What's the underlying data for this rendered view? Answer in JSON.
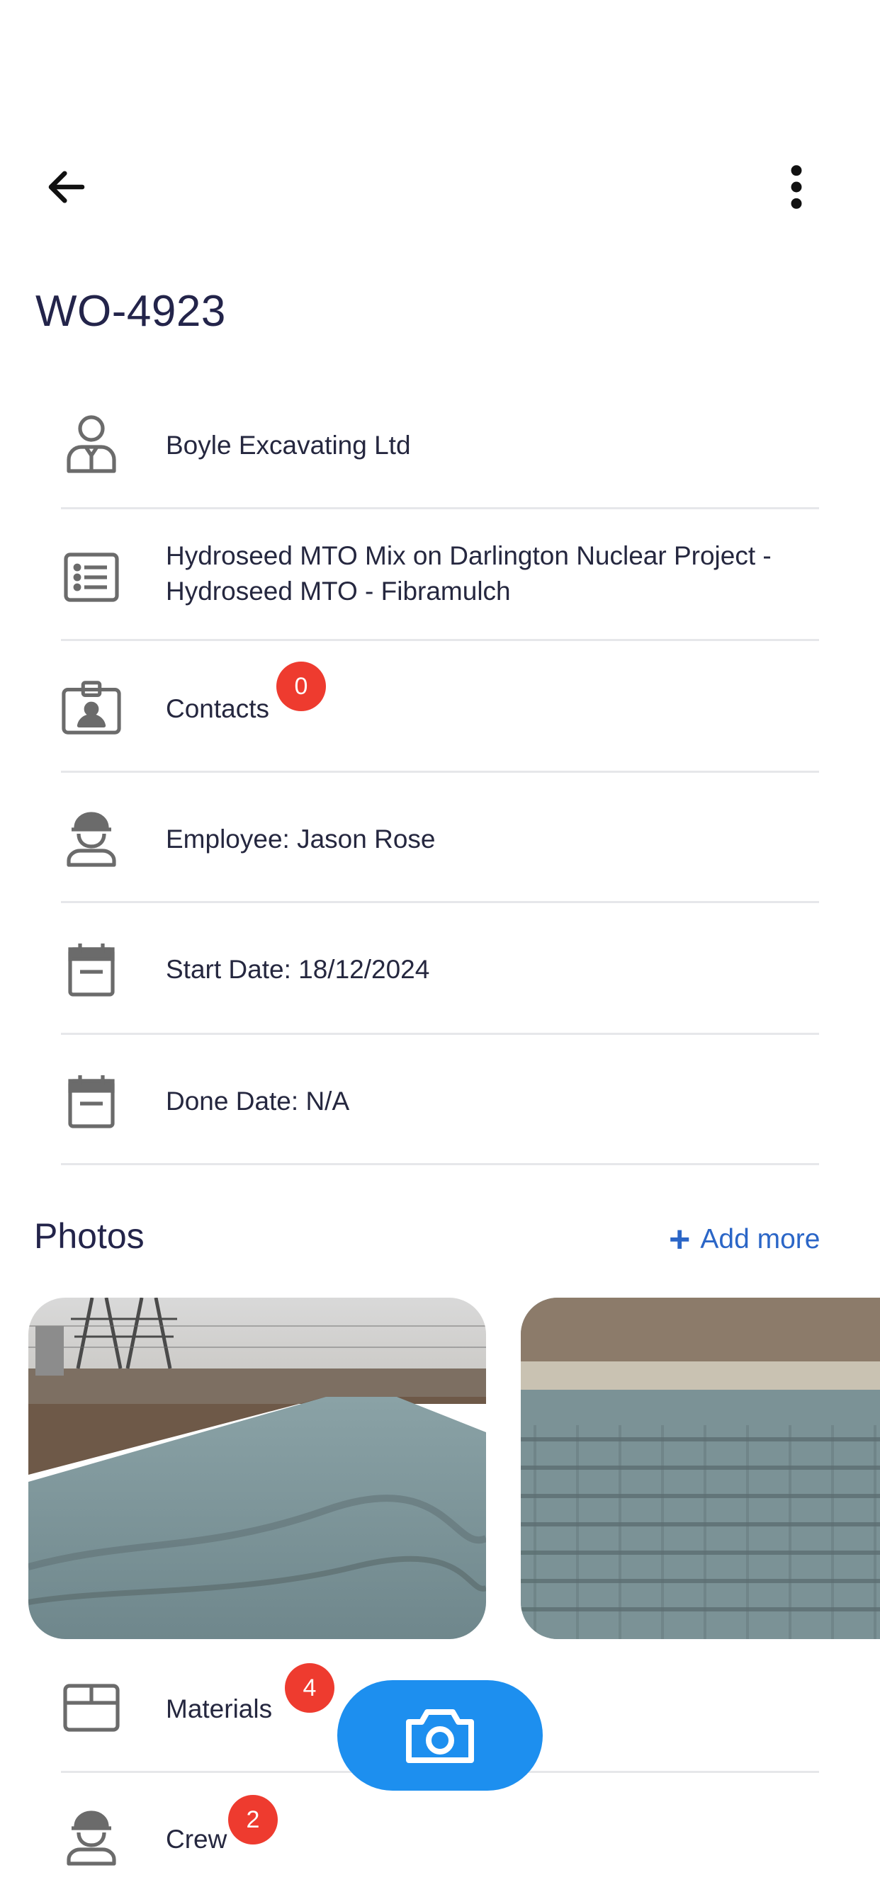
{
  "header": {
    "title": "WO-4923",
    "back_icon": "arrow-left-icon",
    "more_icon": "more-vertical-icon"
  },
  "details": {
    "customer": {
      "label": "Boyle Excavating Ltd",
      "icon": "customer-icon"
    },
    "job": {
      "label": "Hydroseed MTO Mix on Darlington Nuclear Project  - Hydroseed MTO - Fibramulch",
      "icon": "list-icon"
    },
    "contacts": {
      "label": "Contacts",
      "badge": "0",
      "icon": "contact-card-icon"
    },
    "employee": {
      "label": "Employee: Jason Rose",
      "icon": "hardhat-worker-icon"
    },
    "start_date": {
      "label": "Start Date: 18/12/2024",
      "icon": "calendar-icon"
    },
    "done_date": {
      "label": "Done Date: N/A",
      "icon": "calendar-icon"
    }
  },
  "photos": {
    "title": "Photos",
    "add_more_label": "Add more",
    "add_icon": "plus-icon"
  },
  "sections": {
    "materials": {
      "label": "Materials",
      "badge": "4",
      "icon": "box-icon"
    },
    "crew": {
      "label": "Crew",
      "badge": "2",
      "icon": "hardhat-worker-icon"
    }
  },
  "fab": {
    "icon": "camera-icon"
  },
  "colors": {
    "accent_blue": "#1d8fef",
    "link_blue": "#2b66c7",
    "badge_red": "#ee3b2f",
    "text_dark": "#23244a",
    "icon_gray": "#6b6b6b"
  }
}
